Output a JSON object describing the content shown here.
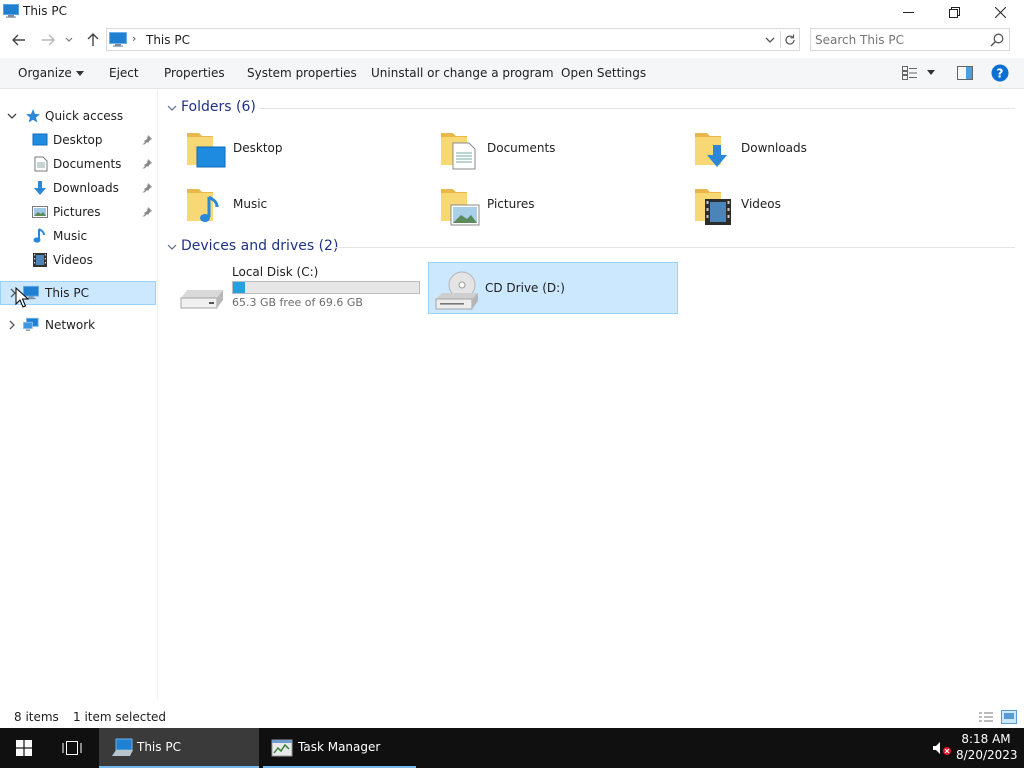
{
  "window": {
    "title": "This PC"
  },
  "address": {
    "crumb": "This PC",
    "search_placeholder": "Search This PC"
  },
  "toolbar": {
    "organize": "Organize",
    "eject": "Eject",
    "properties": "Properties",
    "system_properties": "System properties",
    "uninstall": "Uninstall or change a program",
    "open_settings": "Open Settings"
  },
  "navpane": {
    "quick_access": "Quick access",
    "items": {
      "desktop": "Desktop",
      "documents": "Documents",
      "downloads": "Downloads",
      "pictures": "Pictures",
      "music": "Music",
      "videos": "Videos"
    },
    "this_pc": "This PC",
    "network": "Network"
  },
  "content": {
    "folders_header": "Folders (6)",
    "folders": {
      "desktop": "Desktop",
      "documents": "Documents",
      "downloads": "Downloads",
      "music": "Music",
      "pictures": "Pictures",
      "videos": "Videos"
    },
    "drives_header": "Devices and drives (2)",
    "drives": {
      "c_name": "Local Disk (C:)",
      "c_free": "65.3 GB free of 69.6 GB",
      "c_used_fraction": 0.062,
      "d_name": "CD Drive (D:)"
    }
  },
  "status": {
    "item_count": "8 items",
    "selection": "1 item selected"
  },
  "taskbar": {
    "apps": {
      "this_pc": "This PC",
      "task_manager": "Task Manager"
    },
    "time": "8:18 AM",
    "date": "8/20/2023"
  },
  "colors": {
    "accent": "#0078d7",
    "selection": "#cce8ff",
    "selection_border": "#99d1ff",
    "folder": "#f8d775",
    "drive_fill": "#26a0da",
    "taskbar": "#101010"
  }
}
